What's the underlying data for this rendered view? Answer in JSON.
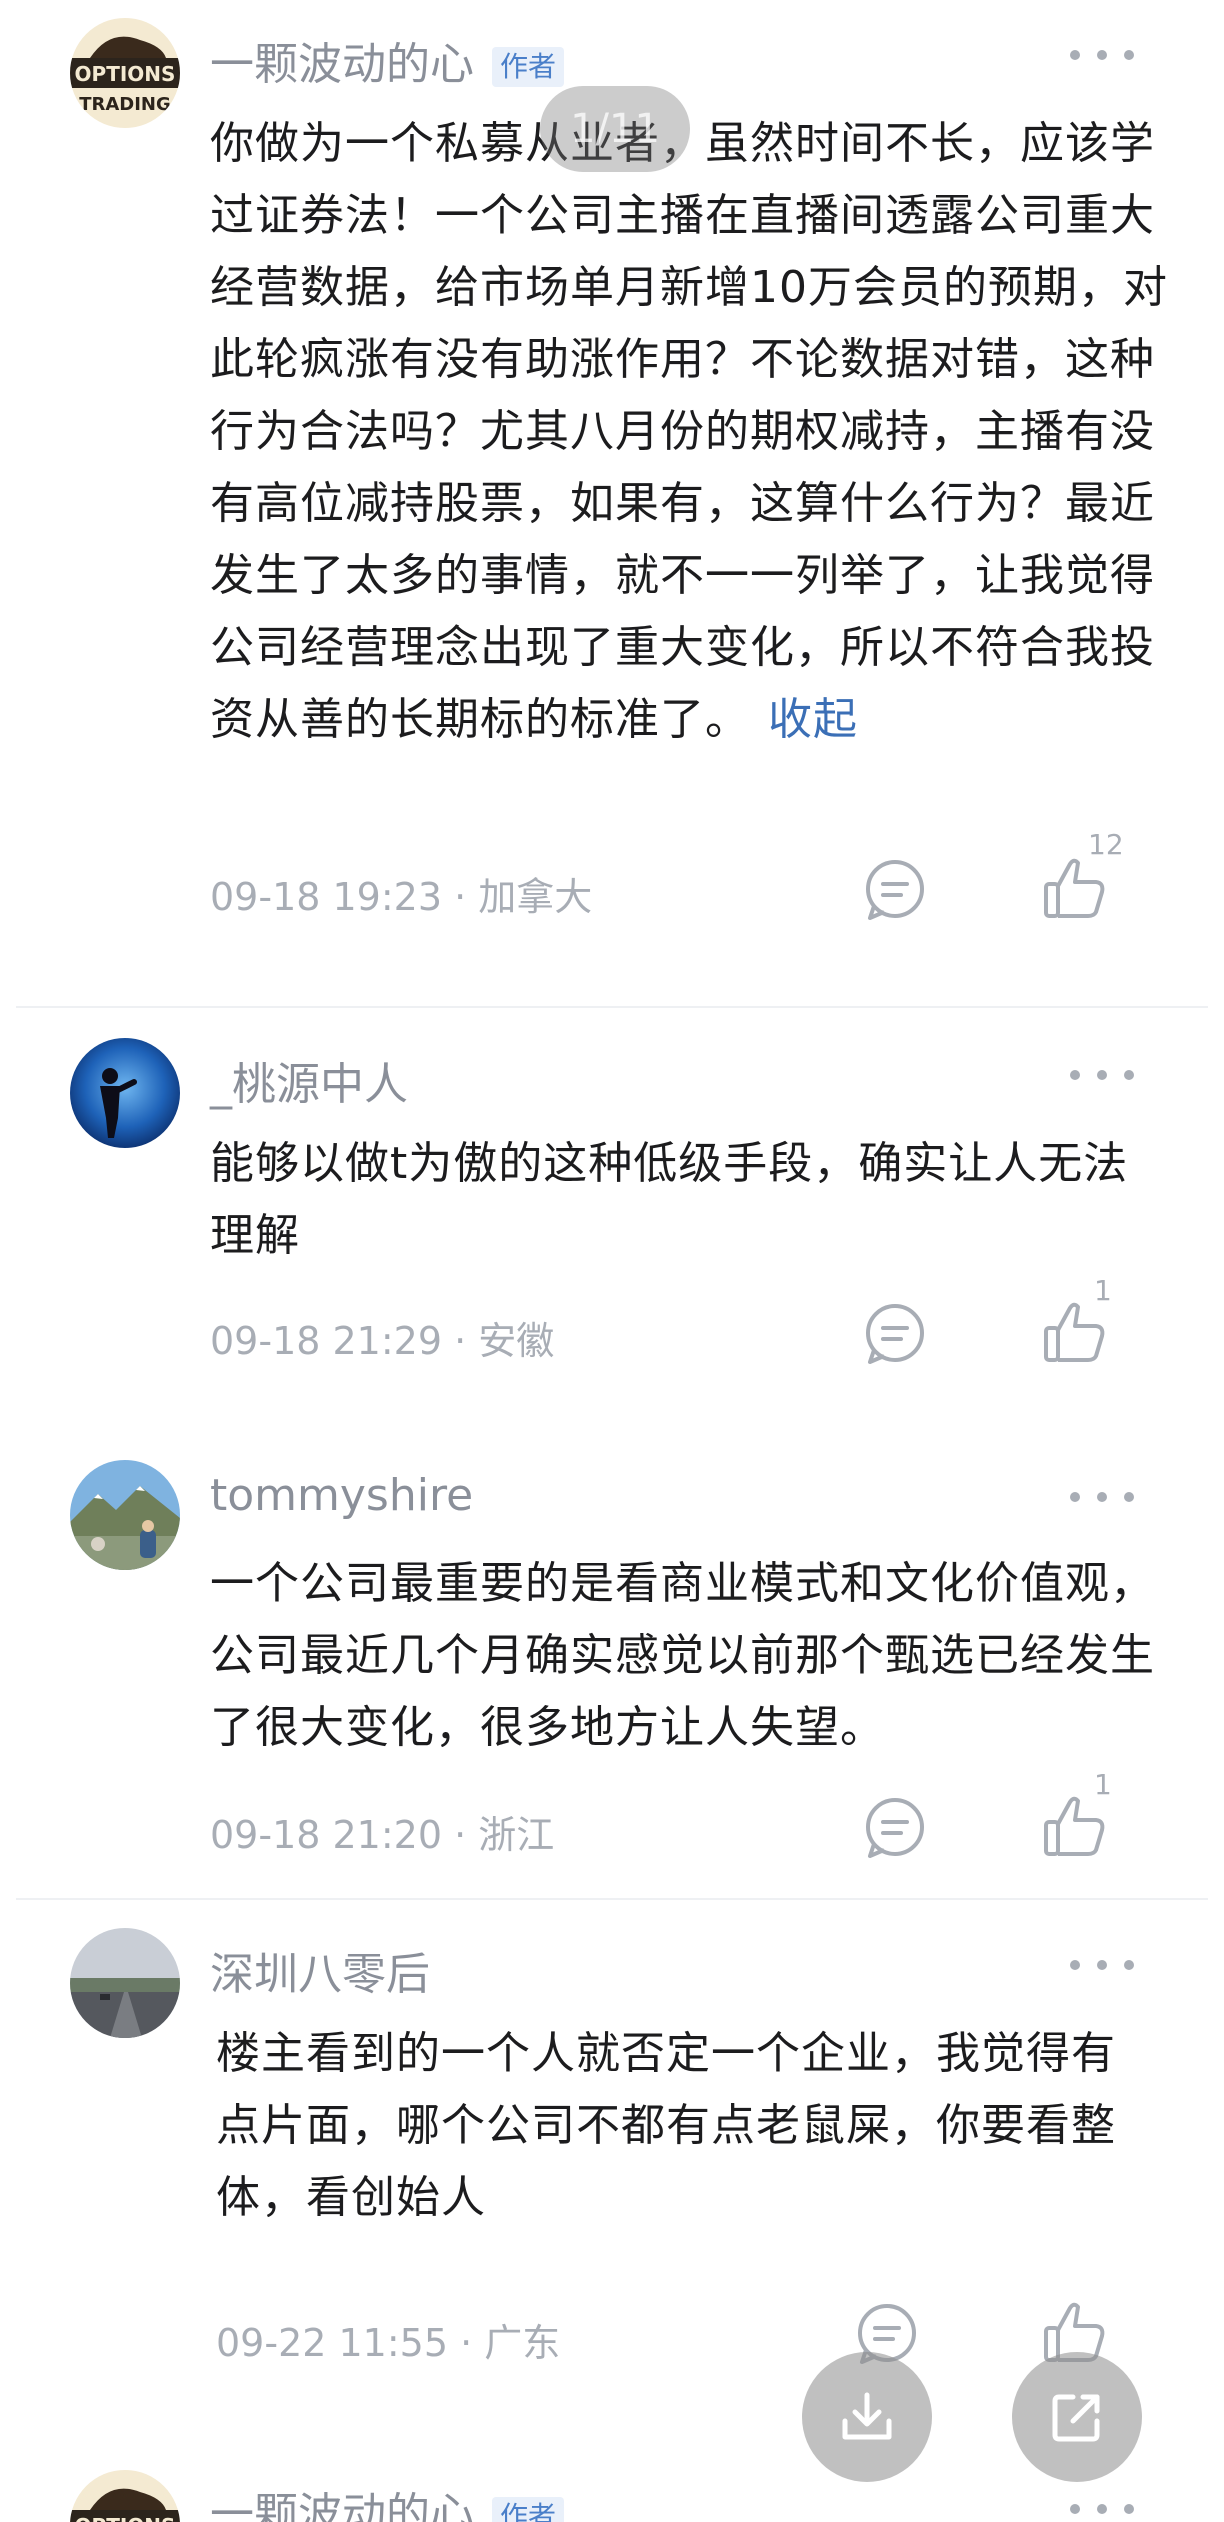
{
  "page_indicator": "1/11",
  "comments": [
    {
      "username": "一颗波动的心",
      "author_badge": "作者",
      "avatar_text": "OPTIONS",
      "body": "你做为一个私募从业者，虽然时间不长，应该学过证券法！一个公司主播在直播间透露公司重大经营数据，给市场单月新增10万会员的预期，对此轮疯涨有没有助涨作用？不论数据对错，这种行为合法吗？尤其八月份的期权减持，主播有没有高位减持股票，如果有，这算什么行为？最近发生了太多的事情，就不一一列举了，让我觉得公司经营理念出现了重大变化，所以不符合我投资从善的长期标的标准了。",
      "collapse_label": "收起",
      "time": "09-18 19:23",
      "location": "加拿大",
      "likes": "12"
    },
    {
      "username": "_桃源中人",
      "body": "能够以做t为傲的这种低级手段，确实让人无法理解",
      "time": "09-18 21:29",
      "location": "安徽",
      "likes": "1"
    },
    {
      "username": "tommyshire",
      "body": "一个公司最重要的是看商业模式和文化价值观，公司最近几个月确实感觉以前那个甄选已经发生了很大变化，很多地方让人失望。",
      "time": "09-18 21:20",
      "location": "浙江",
      "likes": "1"
    },
    {
      "username": "深圳八零后",
      "body": "楼主看到的一个人就否定一个企业，我觉得有点片面，哪个公司不都有点老鼠屎，你要看整体，看创始人",
      "time": "09-22 11:55",
      "location": "广东"
    },
    {
      "username": "一颗波动的心",
      "author_badge": "作者",
      "avatar_text": "OPTIONS"
    }
  ],
  "meta_separator": " · ",
  "icons": {
    "reply": "reply-bubble-icon",
    "like": "thumbs-up-icon",
    "more": "more-dots-icon",
    "download": "download-icon",
    "share": "share-icon"
  },
  "colors": {
    "accent_link": "#3b6fb6",
    "meta_gray": "#a8adb5",
    "badge_bg": "#e9f0fa"
  }
}
